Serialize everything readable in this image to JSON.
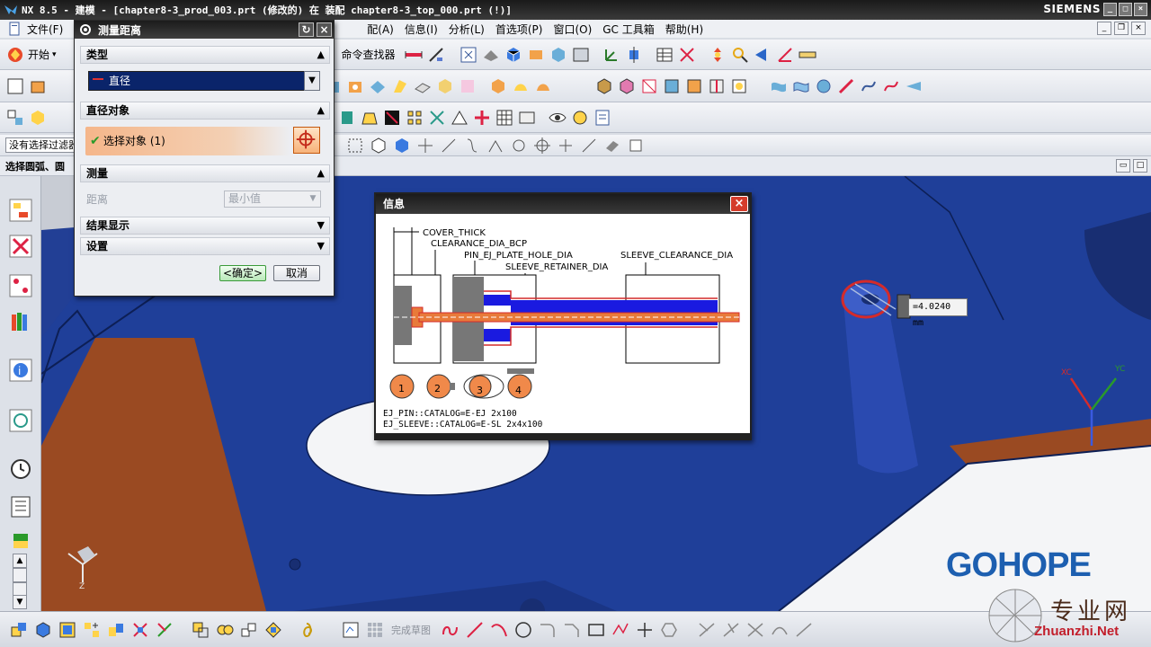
{
  "window": {
    "title": "NX 8.5 - 建模 - [chapter8-3_prod_003.prt (修改的)  在 装配 chapter8-3_top_000.prt   (!)]",
    "brand": "SIEMENS"
  },
  "menu": {
    "items": [
      "文件(F)",
      "配(A)",
      "信息(I)",
      "分析(L)",
      "首选项(P)",
      "窗口(O)",
      "GC 工具箱",
      "帮助(H)"
    ]
  },
  "toolbar": {
    "start_label": "开始",
    "command_finder": "命令查找器",
    "filter_value": "没有选择过滤器",
    "status_prompt": "选择圆弧、圆"
  },
  "dialog": {
    "title": "测量距离",
    "section_type": "类型",
    "type_value": "直径",
    "section_diameter_object": "直径对象",
    "select_object": "选择对象 (1)",
    "section_measure": "测量",
    "distance_label": "距离",
    "distance_value": "最小值",
    "section_results": "结果显示",
    "section_settings": "设置",
    "ok": "<确定>",
    "cancel": "取消"
  },
  "info_window": {
    "title": "信息",
    "labels": {
      "cover_thick": "COVER_THICK",
      "clearance_dia_bcp": "CLEARANCE_DIA_BCP",
      "pin_ej_plate_hole_dia": "PIN_EJ_PLATE_HOLE_DIA",
      "sleeve_retainer_dia": "SLEEVE_RETAINER_DIA",
      "sleeve_clearance_dia": "SLEEVE_CLEARANCE_DIA"
    },
    "circles": [
      "1",
      "2",
      "3",
      "4"
    ],
    "catalog_pin": "EJ_PIN::CATALOG=E-EJ 2x100",
    "catalog_sleeve": "EJ_SLEEVE::CATALOG=E-SL 2x4x100"
  },
  "viewport": {
    "measure_value": "=4.0240 mm",
    "axis_xc": "XC",
    "axis_yc": "YC",
    "axis_z": "Z"
  },
  "bottombar": {
    "finish_sketch": "完成草图"
  },
  "watermark": {
    "brand": "GOHOPE",
    "site_cn": "专业网",
    "site": "Zhuanzhi.Net"
  },
  "colors": {
    "model_blue": "#1f3f99",
    "model_orange": "#a8542a",
    "dialog_title": "#1b1b1b",
    "accent_orange": "#f5b68a"
  }
}
